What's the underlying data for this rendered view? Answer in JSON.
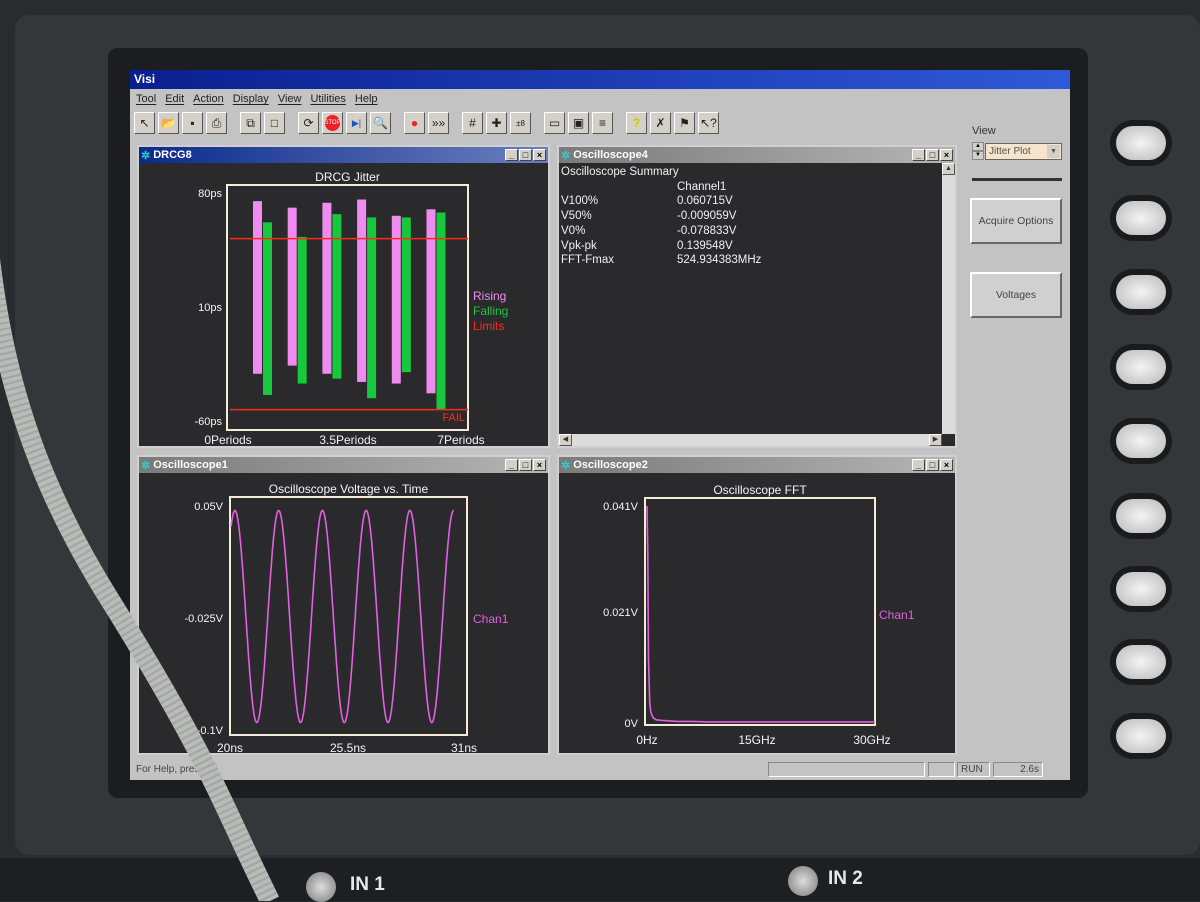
{
  "app": {
    "title": "Visi"
  },
  "menu": [
    "Tool",
    "Edit",
    "Action",
    "Display",
    "View",
    "Utilities",
    "Help"
  ],
  "toolbar": [
    {
      "icon": "pointer-icon",
      "glyph": "↖"
    },
    {
      "icon": "open-folder-icon",
      "glyph": "📂"
    },
    {
      "icon": "save-icon",
      "glyph": "▪"
    },
    {
      "icon": "print-icon",
      "glyph": "⎙"
    },
    null,
    {
      "icon": "copy-icon",
      "glyph": "⧉"
    },
    {
      "icon": "blank-page-icon",
      "glyph": "□"
    },
    null,
    {
      "icon": "acquire-icon",
      "glyph": "⟳"
    },
    {
      "icon": "stop-icon",
      "glyph": "STOP"
    },
    {
      "icon": "step-icon",
      "glyph": "▶|"
    },
    {
      "icon": "zoom-icon",
      "glyph": "🔍"
    },
    null,
    {
      "icon": "record-icon",
      "glyph": "●"
    },
    {
      "icon": "fast-forward-icon",
      "glyph": "»»"
    },
    null,
    {
      "icon": "grid-icon",
      "glyph": "#"
    },
    {
      "icon": "crosshair-icon",
      "glyph": "✚"
    },
    {
      "icon": "numbers-icon",
      "glyph": "±8"
    },
    null,
    {
      "icon": "meter-icon",
      "glyph": "▭"
    },
    {
      "icon": "preview-icon",
      "glyph": "▣"
    },
    {
      "icon": "notes-icon",
      "glyph": "≡"
    },
    null,
    {
      "icon": "help-icon",
      "glyph": "?"
    },
    {
      "icon": "tool-icon",
      "glyph": "✗"
    },
    {
      "icon": "flag-icon",
      "glyph": "⚑"
    },
    {
      "icon": "context-help-icon",
      "glyph": "↖?"
    }
  ],
  "windows": {
    "drcg": {
      "title": "DRCG8"
    },
    "summary": {
      "title": "Oscilloscope4",
      "heading": "Oscilloscope Summary",
      "column": "Channel1",
      "rows": [
        {
          "label": "V100%",
          "value": "0.060715V"
        },
        {
          "label": "V50%",
          "value": "-0.009059V"
        },
        {
          "label": "V0%",
          "value": "-0.078833V"
        },
        {
          "label": "Vpk-pk",
          "value": "0.139548V"
        },
        {
          "label": "FFT-Fmax",
          "value": "524.934383MHz"
        }
      ]
    },
    "osc1": {
      "title": "Oscilloscope1"
    },
    "osc2": {
      "title": "Oscilloscope2"
    }
  },
  "right_panel": {
    "view_label": "View",
    "view_value": "Jitter Plot",
    "acquire_options": "Acquire Options",
    "voltages": "Voltages"
  },
  "status_bar": {
    "help": "For Help, press F1",
    "mode": "RUN",
    "time": "2.6s"
  },
  "hardware": {
    "input1": "IN 1",
    "input2": "IN 2"
  },
  "colors": {
    "rising": "#f08cf0",
    "falling": "#18c83c",
    "limits": "#ff2a1a",
    "trace": "#e060e0",
    "frame": "#f4ecd8",
    "plot_bg": "#2a2a2c"
  },
  "chart_data": [
    {
      "type": "bar",
      "title": "DRCG Jitter",
      "ytick_labels": [
        "80ps",
        "10ps",
        "-60ps"
      ],
      "yticks": [
        80,
        10,
        -60
      ],
      "xtick_labels": [
        "0Periods",
        "3.5Periods",
        "7Periods"
      ],
      "ylim": [
        -60,
        80
      ],
      "unit": "ps",
      "series": [
        {
          "name": "Rising",
          "ranges": [
            [
              -31,
              75
            ],
            [
              -26,
              71
            ],
            [
              -31,
              74
            ],
            [
              -36,
              76
            ],
            [
              -37,
              66
            ],
            [
              -43,
              70
            ]
          ]
        },
        {
          "name": "Falling",
          "ranges": [
            [
              -44,
              62
            ],
            [
              -37,
              53
            ],
            [
              -34,
              67
            ],
            [
              -46,
              65
            ],
            [
              -30,
              65
            ],
            [
              -53,
              68
            ]
          ]
        }
      ],
      "limits": {
        "name": "Limits",
        "upper": 52,
        "lower": -53,
        "fail_label": "FAIL"
      },
      "legend": "right"
    },
    {
      "type": "line",
      "title": "Oscilloscope Voltage vs. Time",
      "xlabel_ticks": [
        "20ns",
        "25.5ns",
        "31ns"
      ],
      "xlim": [
        20,
        31
      ],
      "ytick_labels": [
        "0.05V",
        "-0.025V",
        "-0.1V"
      ],
      "yticks": [
        0.05,
        -0.025,
        -0.1
      ],
      "ylim": [
        -0.1,
        0.05
      ],
      "series": [
        {
          "name": "Chan1",
          "model": "sine",
          "offset_v": -0.024,
          "amplitude_v": 0.071,
          "period_ns": 2.03,
          "first_peak_ns": 20.23,
          "t_start_ns": 20.05,
          "t_end_ns": 30.4
        }
      ]
    },
    {
      "type": "line",
      "title": "Oscilloscope FFT",
      "xlabel_ticks": [
        "0Hz",
        "15GHz",
        "30GHz"
      ],
      "xlim": [
        0,
        30
      ],
      "ytick_labels": [
        "0.041V",
        "0.021V",
        "0V"
      ],
      "yticks": [
        0.041,
        0.021,
        0
      ],
      "ylim": [
        0,
        0.041
      ],
      "series": [
        {
          "name": "Chan1",
          "x": [
            0,
            0.1,
            0.2,
            0.35,
            0.5,
            0.8,
            1.2,
            2,
            3,
            4,
            6,
            8,
            10,
            12,
            15,
            18,
            21,
            24,
            27,
            30
          ],
          "y": [
            0.041,
            0.032,
            0.012,
            0.004,
            0.002,
            0.001,
            0.0006,
            0.0005,
            0.0004,
            0.0003,
            0.0003,
            0.0002,
            0.0002,
            0.0002,
            0.0002,
            0.0002,
            0.0002,
            0.0002,
            0.0002,
            0.0002
          ]
        }
      ]
    }
  ]
}
